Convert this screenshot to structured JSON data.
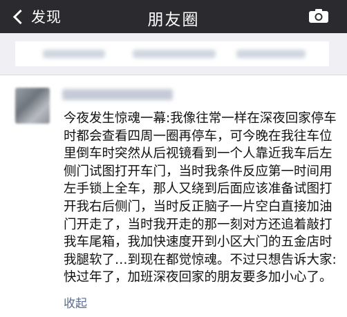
{
  "navbar": {
    "back_label": "发现",
    "title": "朋友圈"
  },
  "post": {
    "text": "今夜发生惊魂一幕:我像往常一样在深夜回家停车时都会查看四周一圈再停车，可今晚在我往车位里倒车时突然从后视镜看到一个人靠近我车后左侧门试图打开车门，当时我条件反应第一时间用左手锁上全车，那人又绕到后面应该准备试图打开我右后侧门，当时反正脑子一片空白直接加油门开走了，当时我开走的那一刻对方还追着敲打我车尾箱，我加快速度开到小区大门的五金店时我腿软了…到现在都觉惊魂。不过只想告诉大家:快过年了，加班深夜回家的朋友要多加小心了。",
    "collapse_label": "收起"
  },
  "icons": {
    "back": "chevron-left-icon",
    "camera": "camera-icon"
  },
  "colors": {
    "navbar_bg": "#2b2b2f",
    "link": "#576b95",
    "page_bg": "#efeff4"
  }
}
